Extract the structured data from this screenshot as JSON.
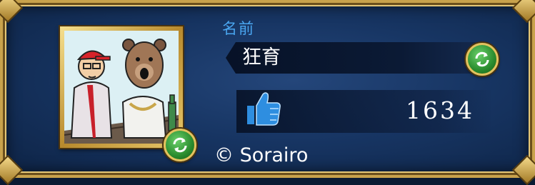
{
  "profile": {
    "name_label": "名前",
    "name_value": "狂育",
    "likes_count": "1634",
    "copyright": "© Sorairo"
  },
  "icons": {
    "like": "thumbs-up-icon",
    "refresh": "refresh-arrows-icon"
  },
  "colors": {
    "frame_gold": "#c8a24c",
    "panel_blue": "#173563",
    "label_blue": "#4aa6f0",
    "refresh_green": "#2a8c2e",
    "like_blue": "#2e8ee0"
  }
}
